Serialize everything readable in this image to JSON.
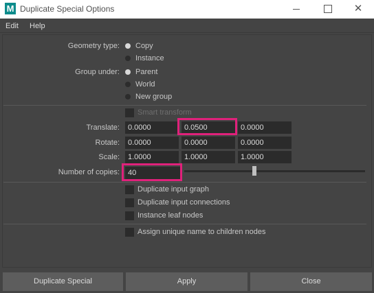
{
  "window": {
    "title": "Duplicate Special Options",
    "close_glyph": "✕"
  },
  "menu": {
    "items": [
      "Edit",
      "Help"
    ]
  },
  "geometry_type": {
    "label": "Geometry type:",
    "options": [
      "Copy",
      "Instance"
    ],
    "selected": "Copy"
  },
  "group_under": {
    "label": "Group under:",
    "options": [
      "Parent",
      "World",
      "New group"
    ],
    "selected": "Parent"
  },
  "smart_transform": {
    "label": "Smart transform",
    "checked": false,
    "enabled": false
  },
  "translate": {
    "label": "Translate:",
    "values": [
      "0.0000",
      "0.0500",
      "0.0000"
    ]
  },
  "rotate": {
    "label": "Rotate:",
    "values": [
      "0.0000",
      "0.0000",
      "0.0000"
    ]
  },
  "scale": {
    "label": "Scale:",
    "values": [
      "1.0000",
      "1.0000",
      "1.0000"
    ]
  },
  "copies": {
    "label": "Number of copies:",
    "value": "40"
  },
  "options": [
    {
      "label": "Duplicate input graph",
      "checked": false
    },
    {
      "label": "Duplicate input connections",
      "checked": false
    },
    {
      "label": "Instance leaf nodes",
      "checked": false
    },
    {
      "label": "Assign unique name to children nodes",
      "checked": false
    }
  ],
  "buttons": {
    "duplicate": "Duplicate Special",
    "apply": "Apply",
    "close": "Close"
  },
  "colors": {
    "highlight": "#e0217b",
    "background": "#444444",
    "field": "#2b2b2b",
    "app_icon": "#0d8c8c"
  }
}
